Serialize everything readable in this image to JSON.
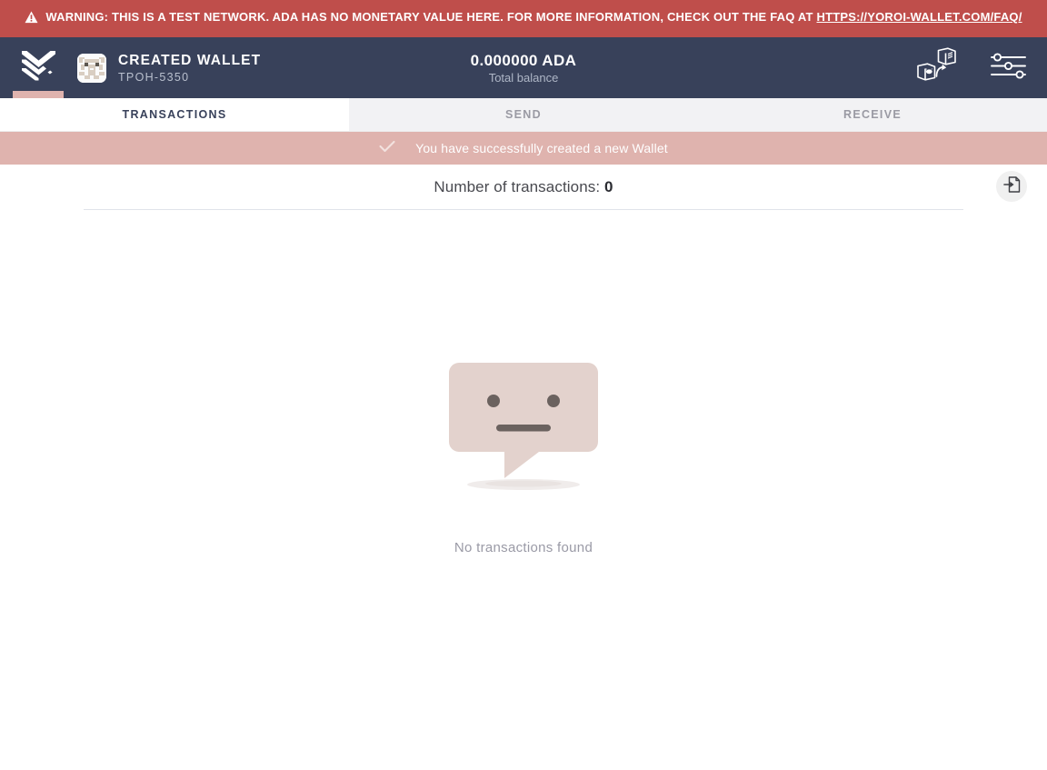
{
  "warning": {
    "icon": "warning-triangle-icon",
    "text_before": "WARNING: THIS IS A TEST NETWORK. ADA HAS NO MONETARY VALUE HERE. FOR MORE INFORMATION, CHECK OUT THE FAQ AT ",
    "link_text": "HTTPS://YOROI-WALLET.COM/FAQ/",
    "bg_color": "#bf4e4b",
    "text_color": "#ffffff"
  },
  "header": {
    "logo_icon": "yoroi-logo-icon",
    "wallet_name": "CREATED WALLET",
    "wallet_ticker": "TPOH-5350",
    "avatar_icon": "wallet-identicon-avatar",
    "balance_amount": "0.000000 ADA",
    "balance_label": "Total balance",
    "bg_color": "#38415a",
    "accent_color": "#dfb3ae",
    "actions": [
      {
        "icon": "switch-wallet-icon",
        "name": "switch-wallet-button"
      },
      {
        "icon": "settings-sliders-icon",
        "name": "settings-button"
      }
    ]
  },
  "tabs": [
    {
      "label": "TRANSACTIONS",
      "active": true
    },
    {
      "label": "SEND",
      "active": false
    },
    {
      "label": "RECEIVE",
      "active": false
    }
  ],
  "notification": {
    "icon": "check-icon",
    "message": "You have successfully created a new Wallet",
    "bg_color": "#dfb3ae",
    "text_color": "#ffffff"
  },
  "main": {
    "tx_count_label": "Number of transactions:",
    "tx_count_value": "0",
    "export_icon": "export-document-icon",
    "empty_illustration": "neutral-face-speech-bubble-icon",
    "empty_message": "No transactions found",
    "illustration_color": "#e3d2cd",
    "illustration_face_color": "#6b625f"
  }
}
